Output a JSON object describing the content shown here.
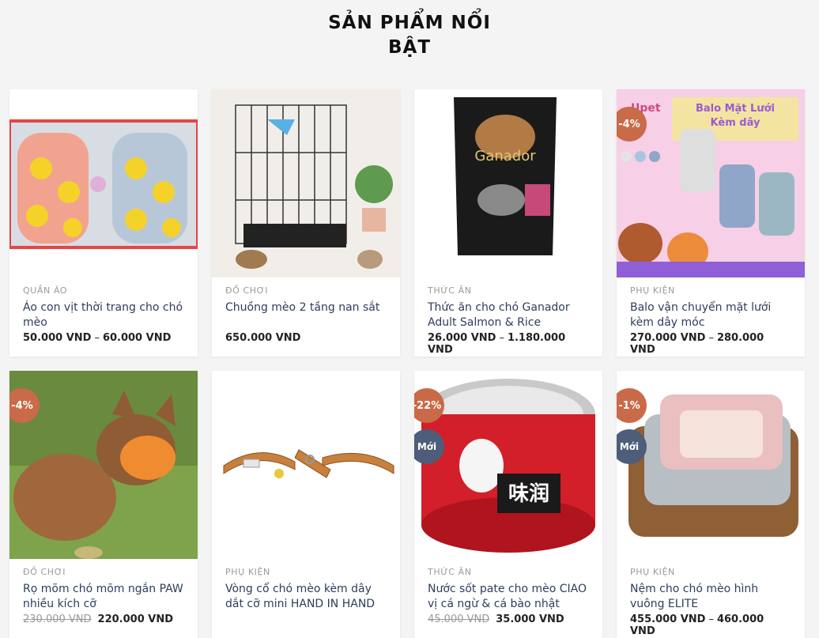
{
  "section": {
    "title_line1": "SẢN PHẨM NỔI",
    "title_line2": "BẬT"
  },
  "products": [
    {
      "category": "QUẦN ÁO",
      "name": "Áo con vịt thời trang cho chó mèo",
      "price_min": "50.000 VND",
      "price_sep": "–",
      "price_max": "60.000 VND",
      "image": "dog-clothes-image"
    },
    {
      "category": "ĐỒ CHƠI",
      "name": "Chuồng mèo 2 tầng nan sắt",
      "price": "650.000 VND",
      "image": "cat-cage-image"
    },
    {
      "category": "THỨC ĂN",
      "name": "Thức ăn cho chó Ganador Adult Salmon & Rice",
      "price_min": "26.000 VND",
      "price_sep": "–",
      "price_max": "1.180.000 VND",
      "image": "dog-food-bag-image",
      "brand_text": "Ganador"
    },
    {
      "category": "PHỤ KIỆN",
      "name": "Balo vận chuyển mặt lưới kèm dây móc",
      "price_min": "270.000 VND",
      "price_sep": "–",
      "price_max": "280.000 VND",
      "badge_sale": "-4%",
      "image": "pet-backpack-image",
      "brand_text": "Upet",
      "banner_text_1": "Balo Mặt Lưới",
      "banner_text_2": "Kèm dây"
    },
    {
      "category": "ĐỒ CHƠI",
      "name": "Rọ mõm chó mõm ngắn PAW nhiều kích cỡ",
      "price_old": "230.000 VND",
      "price": "220.000 VND",
      "badge_sale": "-4%",
      "image": "dog-muzzle-image"
    },
    {
      "category": "PHỤ KIỆN",
      "name": "Vòng cổ chó mèo kèm dây dắt cỡ mini HAND IN HAND",
      "price": "",
      "image": "pet-collar-leash-image"
    },
    {
      "category": "THỨC ĂN",
      "name": "Nước sốt pate cho mèo CIAO vị cá ngừ & cá bào nhật",
      "price_old": "45.000 VND",
      "price": "35.000 VND",
      "badge_sale": "-22%",
      "badge_new": "Mới",
      "image": "cat-pate-can-image",
      "can_text": "味润"
    },
    {
      "category": "PHỤ KIỆN",
      "name": "Nệm cho chó mèo hình vuông ELITE",
      "price_min": "455.000 VND",
      "price_sep": "–",
      "price_max": "460.000 VND",
      "badge_sale": "-1%",
      "badge_new": "Mới",
      "image": "pet-bed-image"
    }
  ],
  "colors": {
    "sale_badge": "#c96a48",
    "new_badge": "#4d5d7a",
    "product_name": "#2f3d5c"
  }
}
